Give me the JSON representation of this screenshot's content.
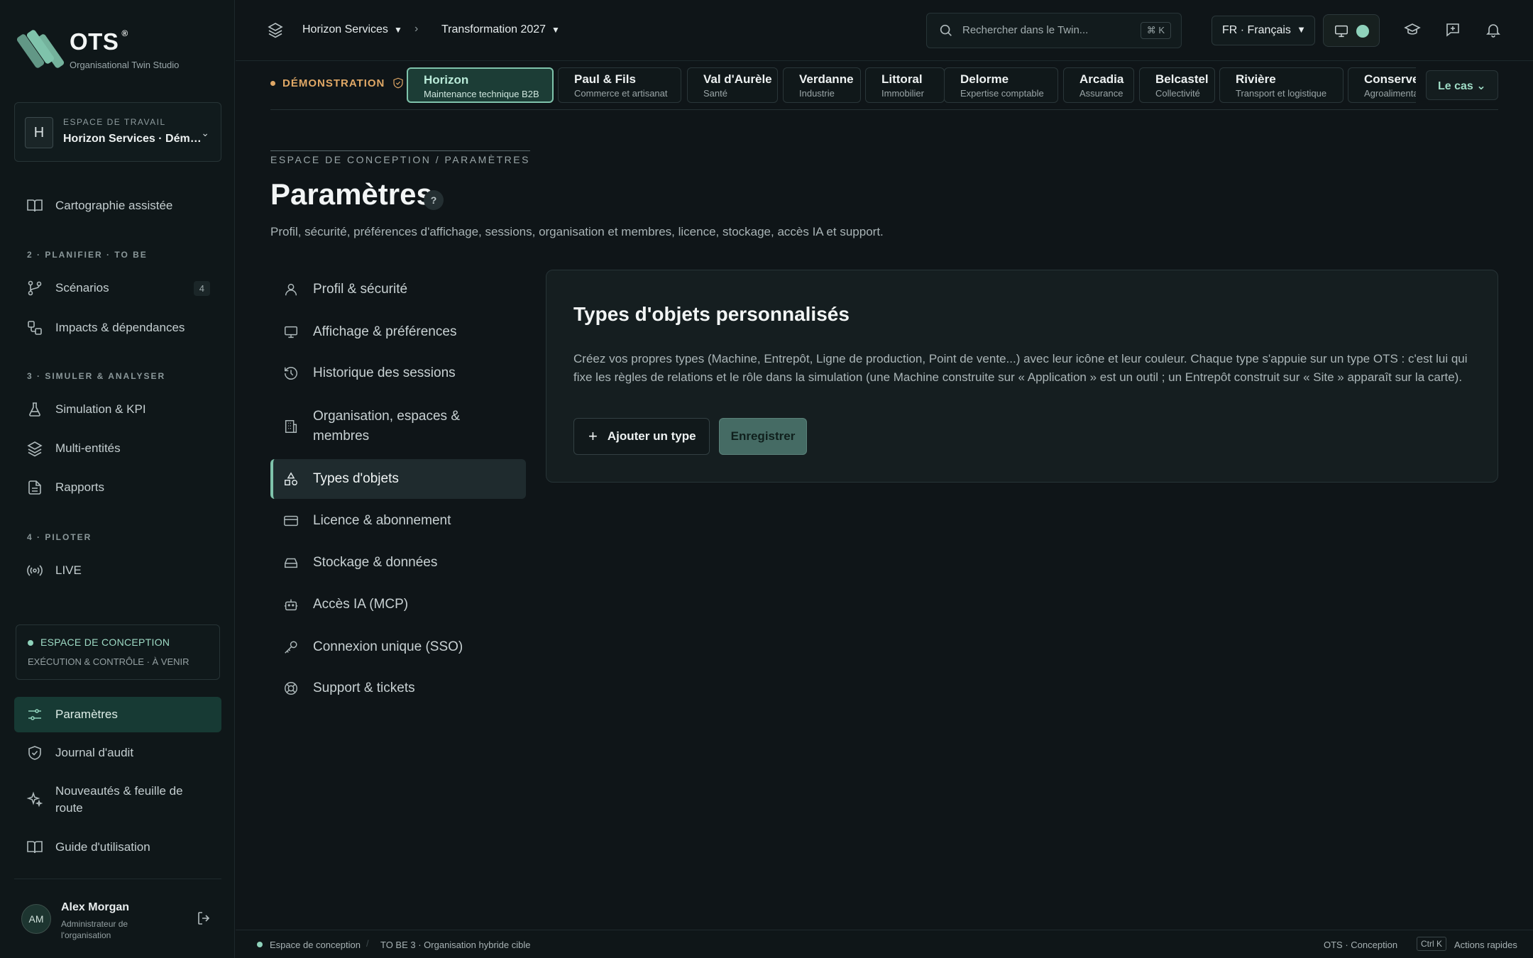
{
  "brand": {
    "name": "OTS",
    "reg": "®",
    "subtitle": "Organisational Twin Studio"
  },
  "workspace": {
    "avatar": "H",
    "label": "ESPACE DE TRAVAIL",
    "name": "Horizon Services · Démonstration"
  },
  "sidebar": {
    "items": [
      {
        "label": "Cartographie assistée"
      },
      {
        "label": "Scénarios",
        "count": "4"
      },
      {
        "label": "Impacts & dépendances"
      },
      {
        "label": "Simulation & KPI"
      },
      {
        "label": "Multi-entités"
      },
      {
        "label": "Rapports"
      },
      {
        "label": "LIVE"
      },
      {
        "label": "Paramètres"
      },
      {
        "label": "Journal d'audit"
      },
      {
        "label": "Nouveautés & feuille de route"
      },
      {
        "label": "Guide d'utilisation"
      }
    ],
    "sections": [
      "2 · PLANIFIER · TO BE",
      "3 · SIMULER & ANALYSER",
      "4 · PILOTER"
    ],
    "conception": {
      "title": "ESPACE DE CONCEPTION",
      "subtitle": "EXÉCUTION & CONTRÔLE · À VENIR"
    }
  },
  "user": {
    "initials": "AM",
    "name": "Alex Morgan",
    "role": "Administrateur de l'organisation"
  },
  "topbar": {
    "crumb1": "Horizon Services",
    "crumb2": "Transformation 2027",
    "search_placeholder": "Rechercher dans le Twin...",
    "search_shortcut": "⌘ K",
    "language": "FR · Français"
  },
  "demo_label": "DÉMONSTRATION",
  "cases": [
    {
      "name": "Horizon",
      "sector": "Maintenance technique B2B",
      "active": true
    },
    {
      "name": "Paul & Fils",
      "sector": "Commerce et artisanat"
    },
    {
      "name": "Val d'Aurèle",
      "sector": "Santé"
    },
    {
      "name": "Verdanne",
      "sector": "Industrie"
    },
    {
      "name": "Littoral",
      "sector": "Immobilier"
    },
    {
      "name": "Delorme",
      "sector": "Expertise comptable"
    },
    {
      "name": "Arcadia",
      "sector": "Assurance"
    },
    {
      "name": "Belcastel",
      "sector": "Collectivité"
    },
    {
      "name": "Rivière",
      "sector": "Transport et logistique"
    },
    {
      "name": "Conserver",
      "sector": "Agroalimentaire"
    }
  ],
  "cases_menu": "Le cas",
  "page": {
    "breadcrumb": "ESPACE DE CONCEPTION / PARAMÈTRES",
    "title": "Paramètres",
    "help": "?",
    "description": "Profil, sécurité, préférences d'affichage, sessions, organisation et membres, licence, stockage, accès IA et support."
  },
  "settings_nav": [
    {
      "label": "Profil & sécurité"
    },
    {
      "label": "Affichage & préférences"
    },
    {
      "label": "Historique des sessions"
    },
    {
      "label": "Organisation, espaces & membres"
    },
    {
      "label": "Types d'objets"
    },
    {
      "label": "Licence & abonnement"
    },
    {
      "label": "Stockage & données"
    },
    {
      "label": "Accès IA (MCP)"
    },
    {
      "label": "Connexion unique (SSO)"
    },
    {
      "label": "Support & tickets"
    }
  ],
  "panel": {
    "title": "Types d'objets personnalisés",
    "description": "Créez vos propres types (Machine, Entrepôt, Ligne de production, Point de vente...) avec leur icône et leur couleur. Chaque type s'appuie sur un type OTS : c'est lui qui fixe les règles de relations et le rôle dans la simulation (une Machine construite sur « Application » est un outil ; un Entrepôt construit sur « Site » apparaît sur la carte).",
    "add_button": "Ajouter un type",
    "save_button": "Enregistrer"
  },
  "statusbar": {
    "left1": "Espace de conception",
    "left2": "TO BE 3 · Organisation hybride cible",
    "right1": "OTS · Conception",
    "shortcut": "Ctrl K",
    "right2": "Actions rapides"
  },
  "colors": {
    "accent": "#8fd2bb",
    "demo": "#e0a866",
    "background": "#0f1518"
  }
}
